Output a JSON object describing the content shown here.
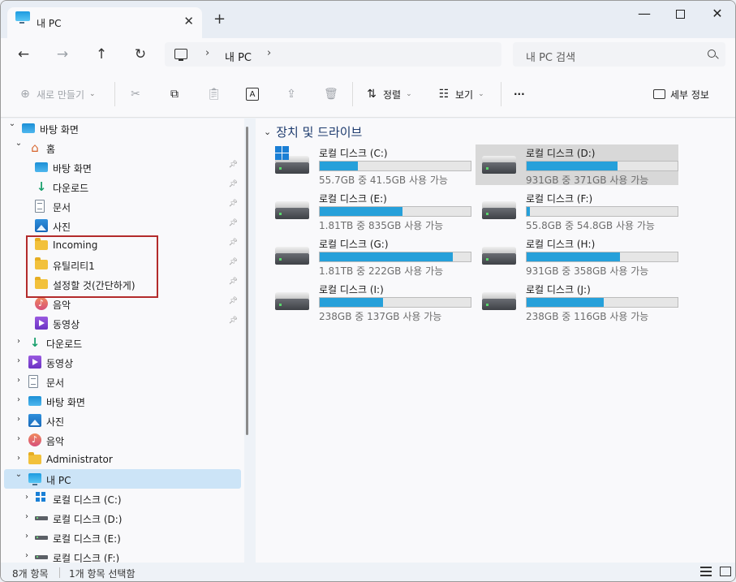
{
  "window": {
    "tab_title": "내 PC",
    "tab_close": "✕",
    "new_tab": "+",
    "minimize": "—",
    "close": "✕"
  },
  "nav": {
    "back": "←",
    "forward": "→",
    "up": "↑",
    "refresh": "↻",
    "breadcrumb_sep": "›",
    "breadcrumb_current": "내 PC",
    "search_placeholder": "내 PC 검색"
  },
  "toolbar": {
    "new": "새로 만들기",
    "sort": "정렬",
    "view": "보기",
    "more": "···",
    "details": "세부 정보"
  },
  "sidebar": {
    "items": [
      {
        "label": "바탕 화면",
        "icon": "desktop-icon"
      },
      {
        "label": "홈",
        "icon": "home-icon"
      },
      {
        "label": "바탕 화면",
        "icon": "desktop-icon",
        "pinned": true
      },
      {
        "label": "다운로드",
        "icon": "download-icon",
        "pinned": true
      },
      {
        "label": "문서",
        "icon": "document-icon",
        "pinned": true
      },
      {
        "label": "사진",
        "icon": "photo-icon",
        "pinned": true
      },
      {
        "label": "Incoming",
        "icon": "folder-icon",
        "pinned": true
      },
      {
        "label": "유틸리티1",
        "icon": "folder-icon",
        "pinned": true
      },
      {
        "label": "설정할 것(간단하게)",
        "icon": "folder-icon",
        "pinned": true
      },
      {
        "label": "음악",
        "icon": "music-icon",
        "pinned": true
      },
      {
        "label": "동영상",
        "icon": "video-icon",
        "pinned": true
      },
      {
        "label": "다운로드",
        "icon": "download-icon"
      },
      {
        "label": "동영상",
        "icon": "video-icon"
      },
      {
        "label": "문서",
        "icon": "document-icon"
      },
      {
        "label": "바탕 화면",
        "icon": "desktop-icon"
      },
      {
        "label": "사진",
        "icon": "photo-icon"
      },
      {
        "label": "음악",
        "icon": "music-icon"
      },
      {
        "label": "Administrator",
        "icon": "folder-icon"
      },
      {
        "label": "내 PC",
        "icon": "pc-icon",
        "selected": true
      },
      {
        "label": "로컬 디스크 (C:)",
        "icon": "windows-drive-icon"
      },
      {
        "label": "로컬 디스크 (D:)",
        "icon": "drive-icon"
      },
      {
        "label": "로컬 디스크 (E:)",
        "icon": "drive-icon"
      },
      {
        "label": "로컬 디스크 (F:)",
        "icon": "drive-icon"
      }
    ]
  },
  "main": {
    "section_title": "장치 및 드라이브",
    "drives": [
      {
        "name": "로컬 디스크 (C:)",
        "free": "55.7GB 중 41.5GB 사용 가능",
        "used_fraction": 0.25
      },
      {
        "name": "로컬 디스크 (D:)",
        "free": "931GB 중 371GB 사용 가능",
        "used_fraction": 0.6,
        "selected": true
      },
      {
        "name": "로컬 디스크 (E:)",
        "free": "1.81TB 중 835GB 사용 가능",
        "used_fraction": 0.55
      },
      {
        "name": "로컬 디스크 (F:)",
        "free": "55.8GB 중 54.8GB 사용 가능",
        "used_fraction": 0.02
      },
      {
        "name": "로컬 디스크 (G:)",
        "free": "1.81TB 중 222GB 사용 가능",
        "used_fraction": 0.88
      },
      {
        "name": "로컬 디스크 (H:)",
        "free": "931GB 중 358GB 사용 가능",
        "used_fraction": 0.62
      },
      {
        "name": "로컬 디스크 (I:)",
        "free": "238GB 중 137GB 사용 가능",
        "used_fraction": 0.42
      },
      {
        "name": "로컬 디스크 (J:)",
        "free": "238GB 중 116GB 사용 가능",
        "used_fraction": 0.51
      }
    ]
  },
  "status": {
    "count": "8개 항목",
    "selected": "1개 항목 선택함"
  },
  "colors": {
    "accent": "#26a0da",
    "selection": "#cce4f7",
    "highlight_box": "#b32b2b"
  }
}
